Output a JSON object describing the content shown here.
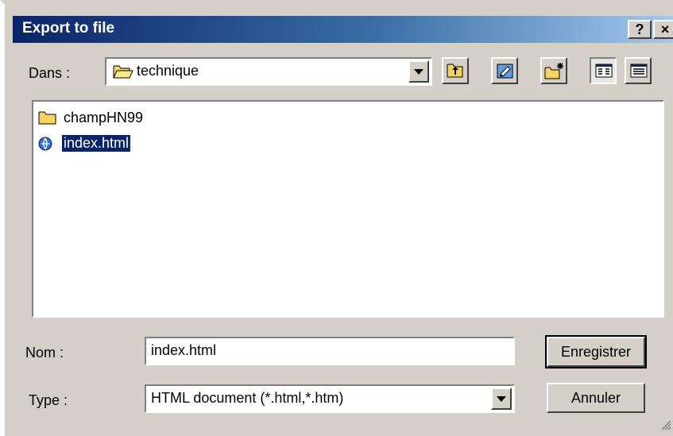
{
  "window": {
    "title": "Export to file",
    "help_label": "?",
    "close_label": "×"
  },
  "location": {
    "label": "Dans :",
    "current_folder": "technique"
  },
  "files": [
    {
      "name": "champHN99",
      "type": "folder",
      "selected": false
    },
    {
      "name": "index.html",
      "type": "html",
      "selected": true
    }
  ],
  "name_field": {
    "label": "Nom :",
    "value": "index.html"
  },
  "type_field": {
    "label": "Type :",
    "value": "HTML document (*.html,*.htm)"
  },
  "buttons": {
    "save": "Enregistrer",
    "cancel": "Annuler"
  },
  "colors": {
    "title_start": "#0a246a",
    "title_end": "#a6caf0",
    "selection": "#0a246a",
    "face": "#d4d0c8"
  }
}
